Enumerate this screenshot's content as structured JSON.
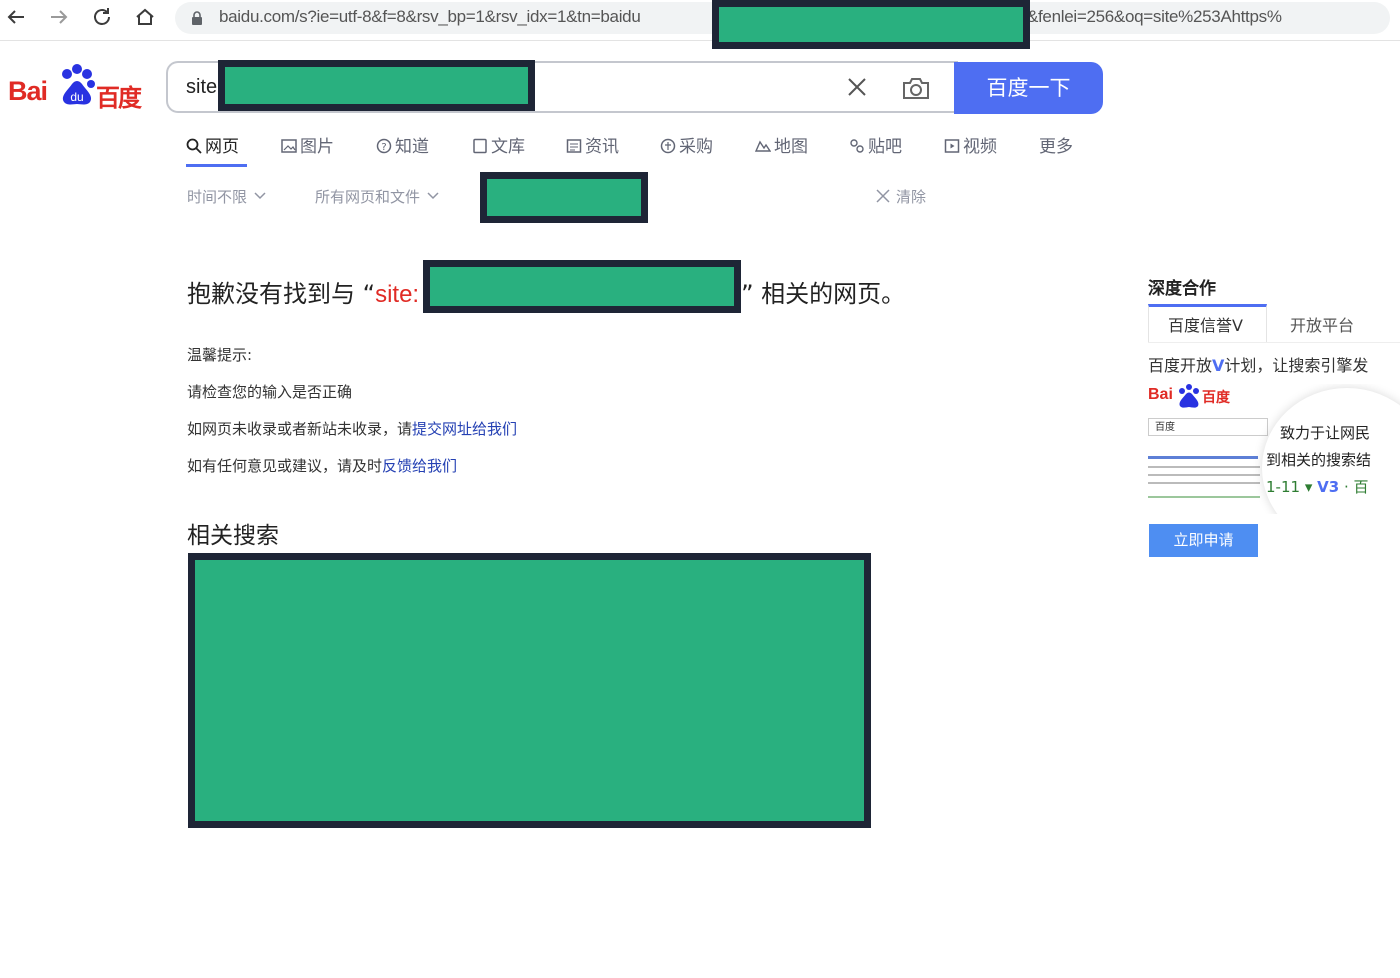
{
  "browser": {
    "url": "baidu.com/s?ie=utf-8&f=8&rsv_bp=1&rsv_idx=1&tn=baidu",
    "url_tail": "62Fzh-cn&fenlei=256&oq=site%253Ahttps%"
  },
  "search": {
    "query": "site",
    "button_label": "百度一下"
  },
  "tabs": [
    {
      "label": "网页",
      "icon": "search-icon"
    },
    {
      "label": "图片",
      "icon": "image-icon"
    },
    {
      "label": "知道",
      "icon": "question-icon"
    },
    {
      "label": "文库",
      "icon": "book-icon"
    },
    {
      "label": "资讯",
      "icon": "news-icon"
    },
    {
      "label": "采购",
      "icon": "shopping-icon"
    },
    {
      "label": "地图",
      "icon": "map-icon"
    },
    {
      "label": "贴吧",
      "icon": "tieba-icon"
    },
    {
      "label": "视频",
      "icon": "video-icon"
    },
    {
      "label": "更多",
      "icon": ""
    }
  ],
  "filters": {
    "time": "时间不限",
    "scope": "所有网页和文件",
    "clear": "清除"
  },
  "main": {
    "no_result_prefix": "抱歉没有找到与",
    "no_result_keyword": "site:",
    "no_result_suffix": "相关的网页。",
    "tips_title": "温馨提示:",
    "tip1": "请检查您的输入是否正确",
    "tip2_prefix": "如网页未收录或者新站未收录，请",
    "tip2_link": "提交网址给我们",
    "tip3_prefix": "如有任何意见或建议，请及时",
    "tip3_link": "反馈给我们",
    "related_title": "相关搜索"
  },
  "right_panel": {
    "title": "深度合作",
    "tab1": "百度信誉V",
    "tab2": "开放平台",
    "desc_prefix": "百度开放",
    "desc_v": "V",
    "desc_suffix": "计划，让搜索引擎发",
    "preview_text1": "致力于让网民",
    "preview_text2": "到相关的搜索结",
    "preview_stat": "1-11",
    "preview_v": "V3",
    "preview_box": "百度",
    "apply_button": "立即申请"
  },
  "colors": {
    "brand_red": "#e02b25",
    "brand_blue": "#4e6ef2",
    "link_blue": "#2440b3",
    "redaction_green": "#29b07f",
    "redaction_border": "#1e2536"
  }
}
